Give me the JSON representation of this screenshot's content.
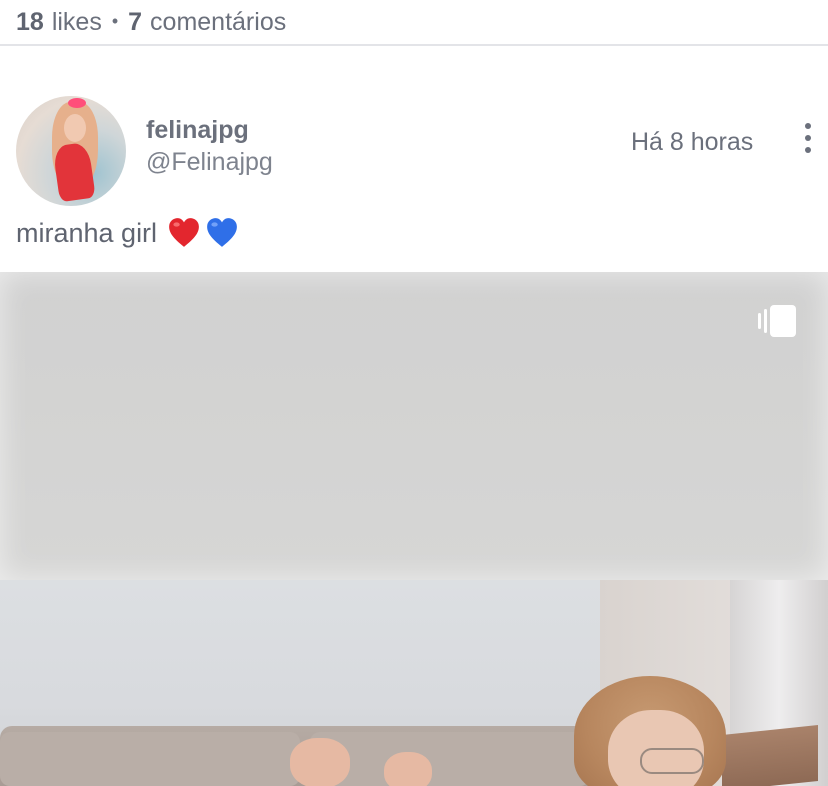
{
  "stats": {
    "likes_count": "18",
    "likes_label": "likes",
    "separator": "•",
    "comments_count": "7",
    "comments_label": "comentários"
  },
  "post": {
    "username": "felinajpg",
    "handle": "@Felinajpg",
    "timestamp": "Há 8 horas",
    "caption": "miranha girl",
    "caption_emojis": [
      "red-heart",
      "blue-heart"
    ],
    "media_type_icon": "carousel-icon"
  },
  "colors": {
    "text_primary": "#6b707c",
    "divider": "#e3e4e8",
    "heart_red": "#e3262e",
    "heart_blue": "#2f6fe8"
  }
}
